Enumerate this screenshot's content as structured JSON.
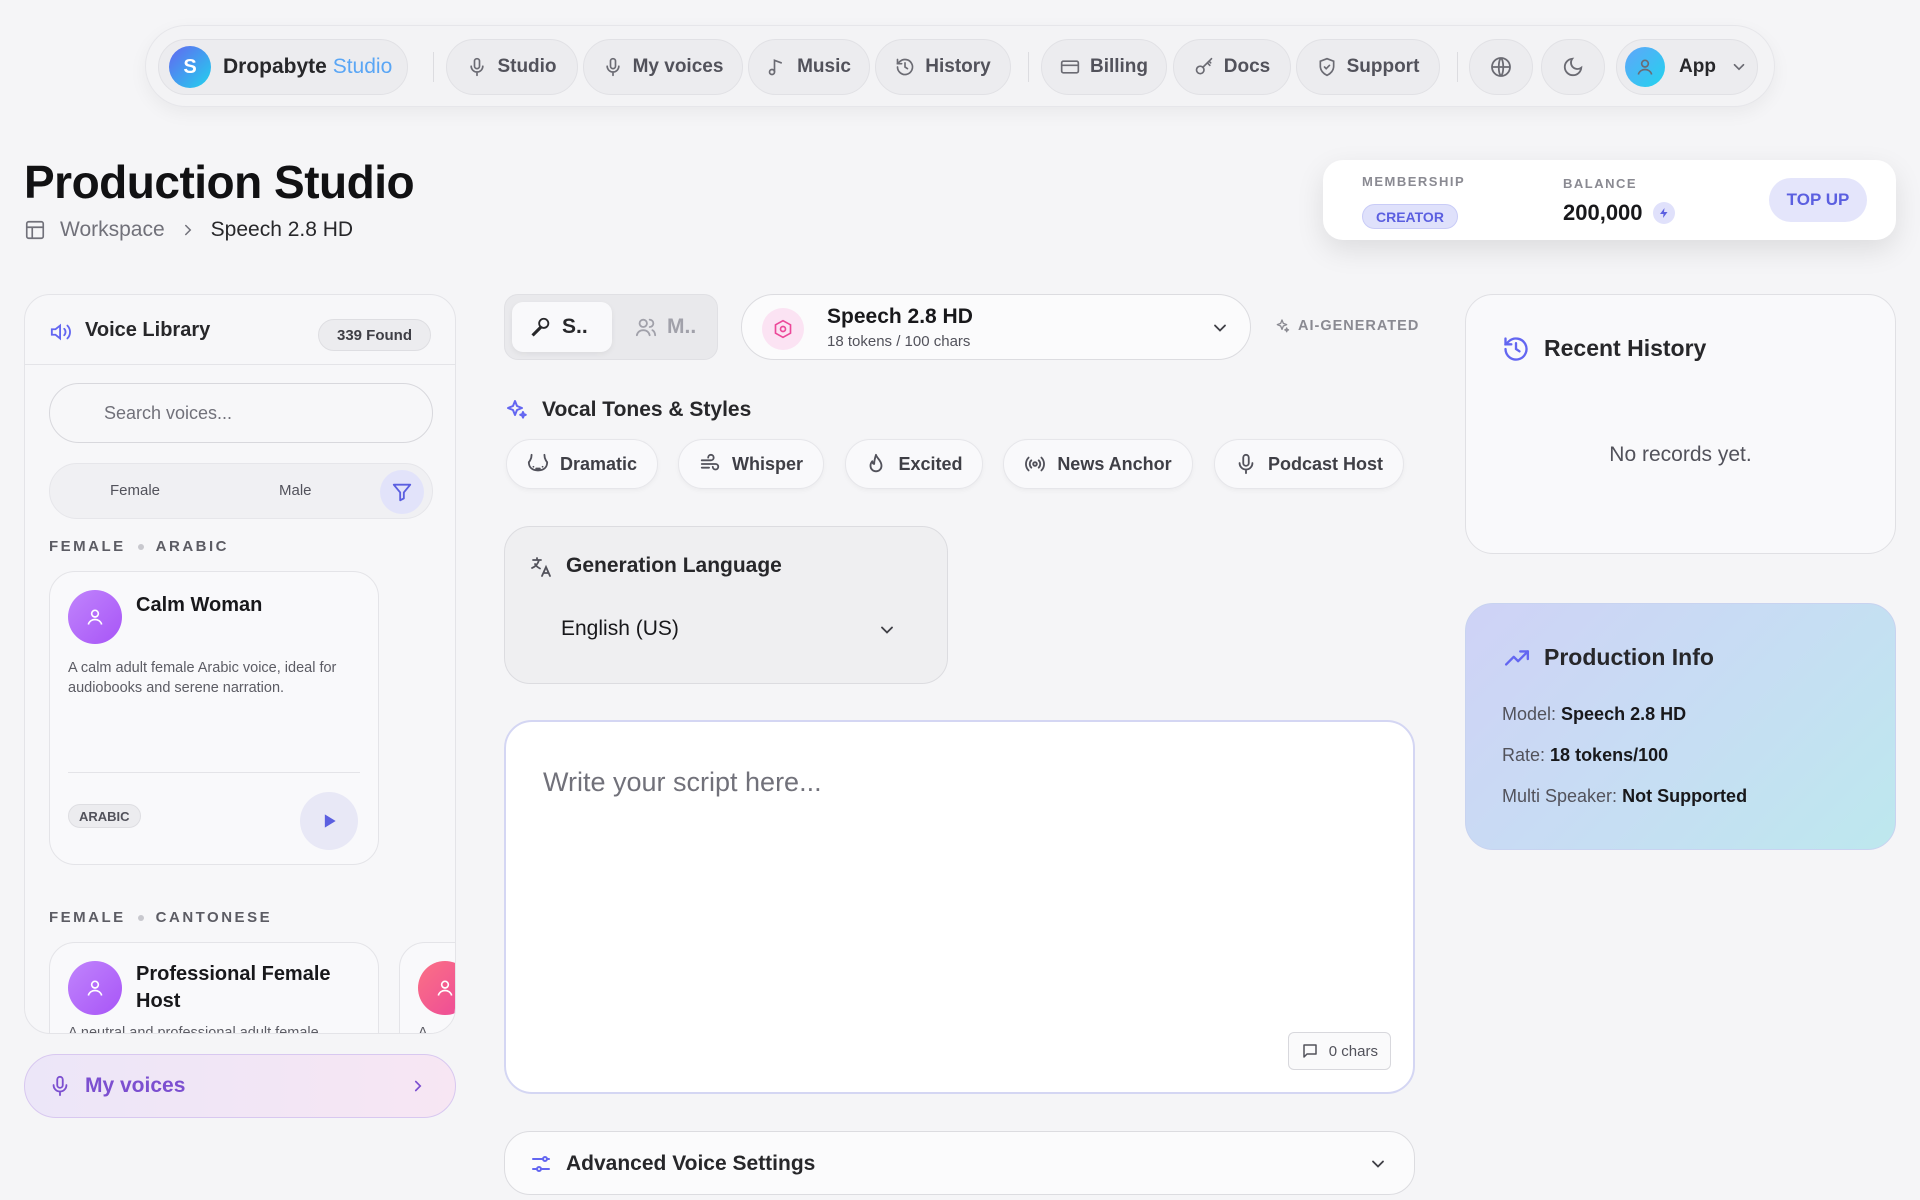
{
  "nav": {
    "brand_letter": "S",
    "brand_name": "Dropabyte",
    "brand_suffix": "Studio",
    "items": [
      {
        "label": "Studio",
        "icon": "mic-icon"
      },
      {
        "label": "My voices",
        "icon": "mic-icon"
      },
      {
        "label": "Music",
        "icon": "music-note-icon"
      },
      {
        "label": "History",
        "icon": "history-icon"
      },
      {
        "label": "Billing",
        "icon": "credit-card-icon"
      },
      {
        "label": "Docs",
        "icon": "key-icon"
      },
      {
        "label": "Support",
        "icon": "shield-icon"
      }
    ],
    "app_label": "App"
  },
  "header": {
    "title": "Production Studio",
    "breadcrumb": [
      "Workspace",
      "Speech 2.8 HD"
    ]
  },
  "account": {
    "membership_label": "MEMBERSHIP",
    "membership_value": "CREATOR",
    "balance_label": "BALANCE",
    "balance_value": "200,000",
    "topup_label": "TOP UP"
  },
  "voice_library": {
    "title": "Voice Library",
    "found": "339 Found",
    "search_placeholder": "Search voices...",
    "gender_options": [
      "Female",
      "Male"
    ],
    "sections": [
      {
        "label_a": "FEMALE",
        "label_b": "ARABIC",
        "voices": [
          {
            "name": "Calm Woman",
            "description": "A calm adult female Arabic voice, ideal for audiobooks and serene narration.",
            "tag": "ARABIC"
          }
        ]
      },
      {
        "label_a": "FEMALE",
        "label_b": "CANTONESE",
        "voices": [
          {
            "name": "Professional Female Host",
            "description": "A neutral and professional adult female",
            "tag": ""
          },
          {
            "name": "",
            "description": "A",
            "tag": ""
          }
        ]
      }
    ],
    "my_voices_label": "My voices"
  },
  "editor": {
    "modes": [
      "S..",
      "M.."
    ],
    "model": {
      "name": "Speech 2.8 HD",
      "rate": "18 tokens / 100 chars"
    },
    "ai_generated": "AI-GENERATED",
    "vocal_title": "Vocal Tones & Styles",
    "styles": [
      {
        "label": "Dramatic",
        "icon": "theater-icon"
      },
      {
        "label": "Whisper",
        "icon": "wind-icon"
      },
      {
        "label": "Excited",
        "icon": "flame-icon"
      },
      {
        "label": "News Anchor",
        "icon": "broadcast-icon"
      },
      {
        "label": "Podcast Host",
        "icon": "mic-icon"
      }
    ],
    "language_title": "Generation Language",
    "language_value": "English (US)",
    "script_placeholder": "Write your script here...",
    "char_count": "0 chars",
    "advanced_title": "Advanced Voice Settings"
  },
  "history": {
    "title": "Recent History",
    "empty": "No records yet."
  },
  "production_info": {
    "title": "Production Info",
    "rows": [
      {
        "label": "Model:",
        "value": "Speech 2.8 HD"
      },
      {
        "label": "Rate:",
        "value": "18 tokens/100"
      },
      {
        "label": "Multi Speaker:",
        "value": "Not Supported"
      }
    ]
  },
  "colors": {
    "accent": "#5b5fe0",
    "purple": "#7c4fd0",
    "brand_gradient_start": "#6366f1",
    "brand_gradient_end": "#22d3ee"
  }
}
